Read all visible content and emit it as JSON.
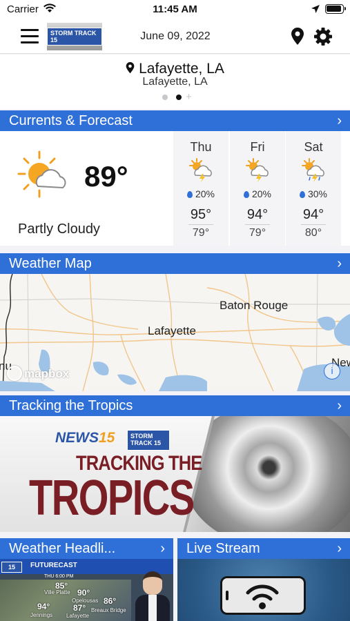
{
  "status_bar": {
    "carrier": "Carrier",
    "time": "11:45 AM"
  },
  "nav": {
    "date": "June 09, 2022",
    "logo_text": "STORM TRACK 15"
  },
  "location": {
    "city": "Lafayette, LA",
    "subtitle": "Lafayette, LA",
    "pages": 2,
    "active_page": 2
  },
  "currents": {
    "header": "Currents & Forecast",
    "temp": "89°",
    "condition": "Partly Cloudy",
    "forecast": [
      {
        "day": "Thu",
        "precip": "20%",
        "hi": "95°",
        "lo": "79°",
        "icon": "thunderstorm-sun-icon"
      },
      {
        "day": "Fri",
        "precip": "20%",
        "hi": "94°",
        "lo": "79°",
        "icon": "thunderstorm-sun-icon"
      },
      {
        "day": "Sat",
        "precip": "30%",
        "hi": "94°",
        "lo": "80°",
        "icon": "thunderstorm-sun-rain-icon"
      }
    ]
  },
  "weather_map": {
    "header": "Weather Map",
    "labels": {
      "baton_rouge": "Baton Rouge",
      "lafayette": "Lafayette",
      "new": "New",
      "edge": "nu"
    },
    "attribution": "mapbox",
    "info": "i"
  },
  "tropics": {
    "header": "Tracking the Tropics",
    "news": "NEWS",
    "news_num": "15",
    "badge": "STORM TRACK 15",
    "title_line1": "TRACKING THE",
    "title_line2": "TROPICS"
  },
  "headlines": {
    "header": "Weather Headli...",
    "bar": "FUTURECAST",
    "badge": "15",
    "time": "THU 6:00 PM",
    "temps": [
      {
        "val": "85°",
        "label": "Ville Platte"
      },
      {
        "val": "90°",
        "label": ""
      },
      {
        "val": "86°",
        "label": "Opelousas"
      },
      {
        "val": "94°",
        "label": ""
      },
      {
        "val": "87°",
        "label": "Lafayette"
      },
      {
        "val": "Jennings",
        "label": ""
      },
      {
        "val": "Breaux Bridge",
        "label": ""
      }
    ]
  },
  "live_stream": {
    "header": "Live Stream"
  },
  "colors": {
    "accent": "#2f6fd8",
    "tropics_red": "#7a1e26"
  }
}
